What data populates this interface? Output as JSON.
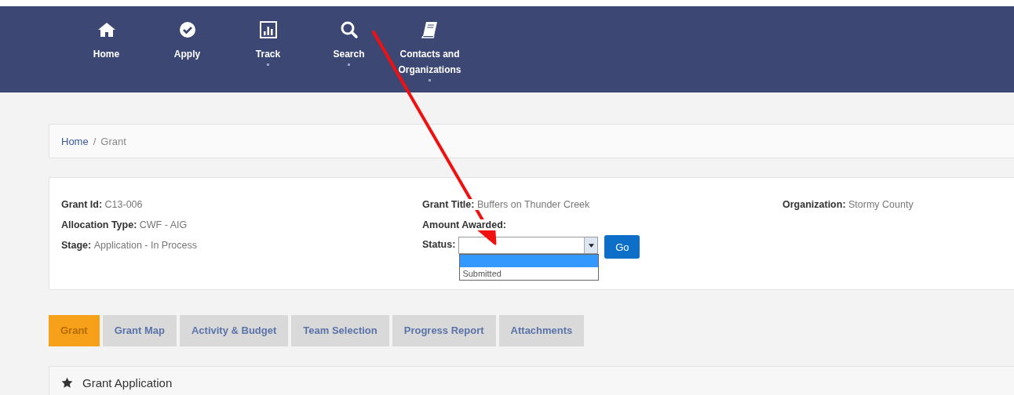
{
  "nav": [
    {
      "label": "Home",
      "has_menu": false
    },
    {
      "label": "Apply",
      "has_menu": false
    },
    {
      "label": "Track",
      "has_menu": true
    },
    {
      "label": "Search",
      "has_menu": true
    },
    {
      "label": "Contacts and Organizations",
      "has_menu": true
    }
  ],
  "breadcrumb": {
    "separator": "/",
    "items": [
      {
        "label": "Home",
        "link": true
      },
      {
        "label": "Grant",
        "link": false
      }
    ]
  },
  "details": [
    [
      {
        "label": "Grant Id:",
        "value": "C13-006"
      },
      {
        "label": "Allocation Type:",
        "value": "CWF - AIG"
      },
      {
        "label": "Stage:",
        "value": "Application - In Process"
      }
    ],
    [
      {
        "label": "Grant Title:",
        "value": "Buffers on Thunder Creek"
      },
      {
        "label": "Amount Awarded:"
      }
    ],
    [
      {
        "label": "Organization:",
        "value": "Stormy County"
      }
    ]
  ],
  "status": {
    "label": "Status:",
    "expanded": true,
    "options": [
      {
        "selected": true
      },
      {
        "label": "Submitted",
        "selected": false
      }
    ],
    "button": "Go"
  },
  "tabs": [
    {
      "label": "Grant",
      "selected": true
    },
    {
      "label": "Grant Map",
      "selected": false
    },
    {
      "label": "Activity & Budget",
      "selected": false
    },
    {
      "label": "Team Selection",
      "selected": false
    },
    {
      "label": "Progress Report",
      "selected": false
    },
    {
      "label": "Attachments",
      "selected": false
    }
  ],
  "panel": {
    "title": "Grant Application"
  }
}
